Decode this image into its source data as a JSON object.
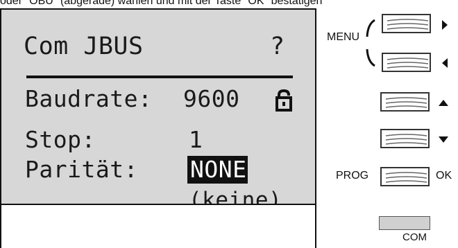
{
  "instruction": {
    "top_text": "oder \"OBU\" (abgerade) wählen und mit der Taste \"OK\" bestätigen"
  },
  "lcd": {
    "title": "Com JBUS",
    "help_symbol": "?",
    "rows": [
      {
        "label": "Baudrate:",
        "value": "9600",
        "lock": true
      },
      {
        "label": "Stop:",
        "value": "1"
      },
      {
        "label": "Parität:",
        "value": "NONE",
        "selected": true,
        "description": "(keine)"
      }
    ]
  },
  "keys": {
    "menu_label": "MENU",
    "prog_label": "PROG",
    "ok_label": "OK",
    "com_label": "COM"
  },
  "icons": {
    "lock": "lock-icon",
    "right": "arrow-right-icon",
    "left": "arrow-left-icon",
    "up": "arrow-up-icon",
    "down": "arrow-down-icon"
  },
  "colors": {
    "lcd_background": "#d7d7d7",
    "text": "#1a1a1a",
    "selected_bg": "#111111",
    "selected_fg": "#ffffff",
    "com_key": "#d0d0d0"
  }
}
